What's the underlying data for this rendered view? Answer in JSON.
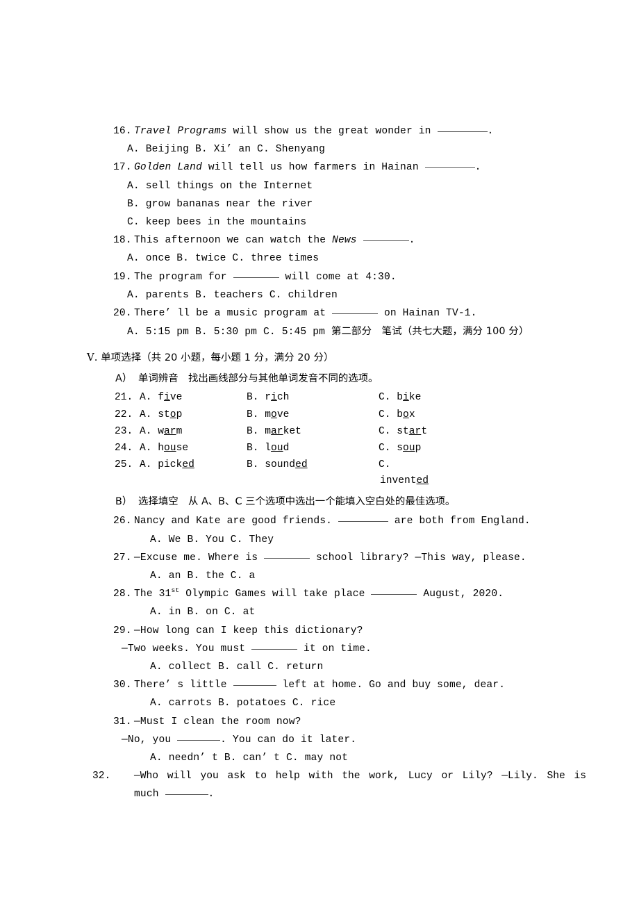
{
  "document": {
    "language": "zh-CN-en",
    "page_background": "#ffffff",
    "text_color": "#000000"
  },
  "listening_tail": {
    "questions": [
      {
        "number": "16.",
        "italic_lead": "Travel Programs",
        "stem_after": " will show us the great wonder in ",
        "stem_end": ".",
        "options_lines": [
          "A. Beijing    B. Xi’ an   C. Shenyang"
        ]
      },
      {
        "number": "17.",
        "italic_lead": "Golden Land",
        "stem_after": " will tell us how farmers in Hainan ",
        "stem_end": ".",
        "options_lines": [
          "A. sell things on the Internet",
          "B. grow bananas near the river",
          "C. keep bees in the mountains"
        ]
      },
      {
        "number": "18.",
        "stem_before": "This afternoon we can watch the ",
        "italic_mid": "News",
        "stem_end": ".",
        "options_lines": [
          "A. once   B. twice    C. three times"
        ]
      },
      {
        "number": "19.",
        "stem_before": "The program for ",
        "stem_after": " will come at 4:30.",
        "options_lines": [
          "A. parents    B. teachers C. children"
        ]
      },
      {
        "number": "20.",
        "stem_before": "There’ ll be a music program at ",
        "stem_after": " on Hainan TV-1.",
        "options_lines": [
          "A. 5:15 pm    B. 5:30 pm  C. 5:45 pm "
        ],
        "options_tail_cn": "第二部分　笔试（共七大题，满分 100 分）"
      }
    ]
  },
  "section_v": {
    "roman": "Ⅴ",
    "roman_dot": ".",
    "title_cn": " 单项选择（共 20 小题，每小题 1 分，满分 20 分）",
    "part_a": {
      "label": "A）",
      "title": "单词辨音　找出画线部分与其他单词发音不同的选项。",
      "rows": [
        {
          "number": "21.",
          "a": {
            "letter": "A.",
            "pre": "f",
            "u": "i",
            "post": "ve"
          },
          "b": {
            "letter": "B.",
            "pre": "r",
            "u": "i",
            "post": "ch"
          },
          "c": {
            "letter": "C.",
            "pre": "b",
            "u": "i",
            "post": "ke"
          }
        },
        {
          "number": "22.",
          "a": {
            "letter": "A.",
            "pre": "st",
            "u": "o",
            "post": "p"
          },
          "b": {
            "letter": "B.",
            "pre": "m",
            "u": "o",
            "post": "ve"
          },
          "c": {
            "letter": "C.",
            "pre": "b",
            "u": "o",
            "post": "x"
          }
        },
        {
          "number": "23.",
          "a": {
            "letter": "A.",
            "pre": "w",
            "u": "ar",
            "post": "m"
          },
          "b": {
            "letter": "B.",
            "pre": "m",
            "u": "ar",
            "post": "ket"
          },
          "c": {
            "letter": "C.",
            "pre": "st",
            "u": "ar",
            "post": "t"
          }
        },
        {
          "number": "24.",
          "a": {
            "letter": "A.",
            "pre": "h",
            "u": "ou",
            "post": "se"
          },
          "b": {
            "letter": "B.",
            "pre": "l",
            "u": "ou",
            "post": "d"
          },
          "c": {
            "letter": "C.",
            "pre": "s",
            "u": "ou",
            "post": "p"
          }
        },
        {
          "number": "25.",
          "a": {
            "letter": "A.",
            "pre": "pick",
            "u": "ed",
            "post": ""
          },
          "b": {
            "letter": "B.",
            "pre": "sound",
            "u": "ed",
            "post": ""
          },
          "c": {
            "letter": "C.",
            "pre": "",
            "u": "",
            "post": ""
          },
          "c_wrapped": {
            "pre": "invent",
            "u": "ed",
            "post": ""
          }
        }
      ]
    },
    "part_b": {
      "label": "B）",
      "title": "选择填空　从 A、B、C 三个选项中选出一个能填入空白处的最佳选项。",
      "questions": [
        {
          "number": "26.",
          "stem_before": "Nancy and Kate are good friends. ",
          "stem_after": " are both from England.",
          "options": "A. We B. You  C. They"
        },
        {
          "number": "27.",
          "stem_before": "—Excuse me. Where is ",
          "stem_after": " school library?       —This way, please.",
          "options": "A. an B. the  C. a"
        },
        {
          "number": "28.",
          "stem_before": "The 31",
          "superscript": "st",
          "stem_mid": " Olympic Games will take place ",
          "stem_after": " August, 2020.",
          "options": "A. in B.  on   C. at"
        },
        {
          "number": "29.",
          "line1": "—How long can I keep this dictionary?",
          "line2_before": "—Two weeks. You must ",
          "line2_after": " it on time.",
          "options": "A. collect   B. call C. return"
        },
        {
          "number": "30.",
          "stem_before": "There’ s little ",
          "stem_after": " left at home. Go and buy some, dear.",
          "options": "A. carrots   B. potatoes C. rice"
        },
        {
          "number": "31.",
          "line1": "—Must I clean the room now?",
          "line2_before": "—No, you ",
          "line2_after": ". You can do it later.",
          "options": "A. needn’ t  B. can’ t          C. may not"
        },
        {
          "number": "32.",
          "line1": "—Who will you ask to help with the work, Lucy or Lily? —Lily. She is",
          "line2_before": "much ",
          "line2_after": "."
        }
      ]
    }
  }
}
